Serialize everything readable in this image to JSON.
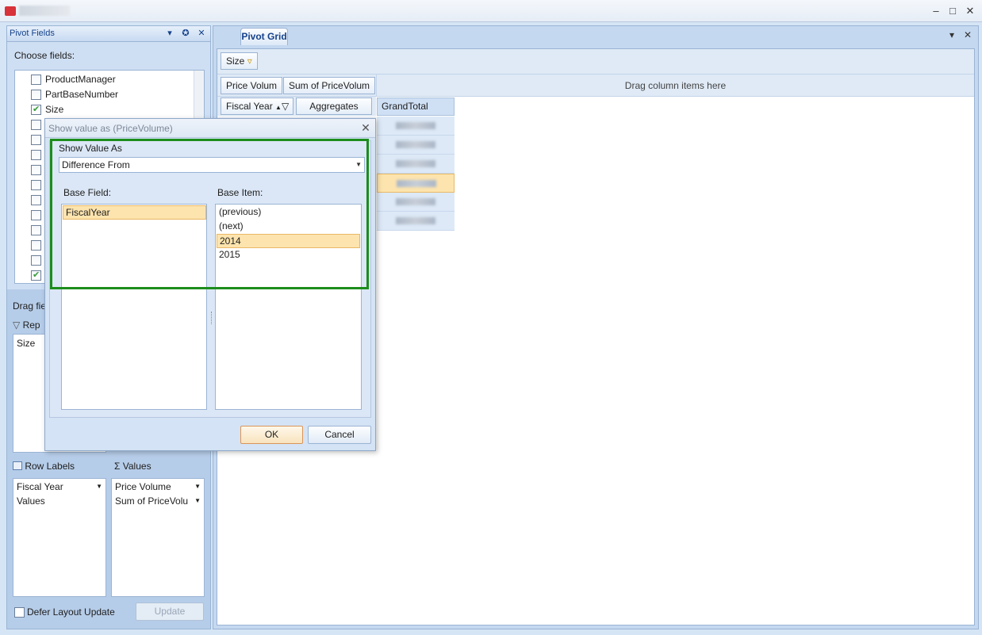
{
  "window": {
    "controls": {
      "minimize": "–",
      "maximize": "□",
      "close": "✕"
    }
  },
  "pivot_fields": {
    "title": "Pivot Fields",
    "choose_label": "Choose fields:",
    "fields": [
      {
        "name": "ProductManager",
        "checked": false
      },
      {
        "name": "PartBaseNumber",
        "checked": false
      },
      {
        "name": "Size",
        "checked": true
      },
      {
        "name": "",
        "checked": false
      },
      {
        "name": "",
        "checked": false
      },
      {
        "name": "",
        "checked": false
      },
      {
        "name": "",
        "checked": false
      },
      {
        "name": "",
        "checked": false
      },
      {
        "name": "",
        "checked": false
      },
      {
        "name": "",
        "checked": false
      },
      {
        "name": "",
        "checked": false
      },
      {
        "name": "",
        "checked": false
      },
      {
        "name": "",
        "checked": false
      },
      {
        "name": "",
        "checked": true
      }
    ],
    "drag_label": "Drag fie",
    "report_filter_label": "Rep",
    "report_filter_items": [
      "Size"
    ],
    "row_labels_label": "Row Labels",
    "row_labels_items": [
      "Fiscal Year",
      "Values"
    ],
    "values_label": "Values",
    "values_items": [
      "Price Volume",
      "Sum of PriceVolu"
    ],
    "defer_label": "Defer Layout Update",
    "update_label": "Update"
  },
  "pivot_grid": {
    "tab_label": "Pivot Grid",
    "filter_field": "Size",
    "data_fields": [
      "Price Volum",
      "Sum of PriceVolum"
    ],
    "column_drop_hint": "Drag column items here",
    "row_field": "Fiscal Year",
    "aggregates_label": "Aggregates",
    "grand_total_label": "GrandTotal",
    "selected_row_index": 3
  },
  "dialog": {
    "title": "Show value as (PriceVolume)",
    "group_label": "Show Value As",
    "show_value_as": "Difference From",
    "base_field_label": "Base Field:",
    "base_item_label": "Base Item:",
    "base_fields": [
      "FiscalYear"
    ],
    "selected_base_field": "FiscalYear",
    "base_items": [
      "(previous)",
      "(next)",
      "2014",
      "2015"
    ],
    "selected_base_item": "2014",
    "ok_label": "OK",
    "cancel_label": "Cancel"
  },
  "colors": {
    "highlight": "#1c8d1c",
    "selection": "#fde4ae",
    "accent": "#15428b"
  }
}
